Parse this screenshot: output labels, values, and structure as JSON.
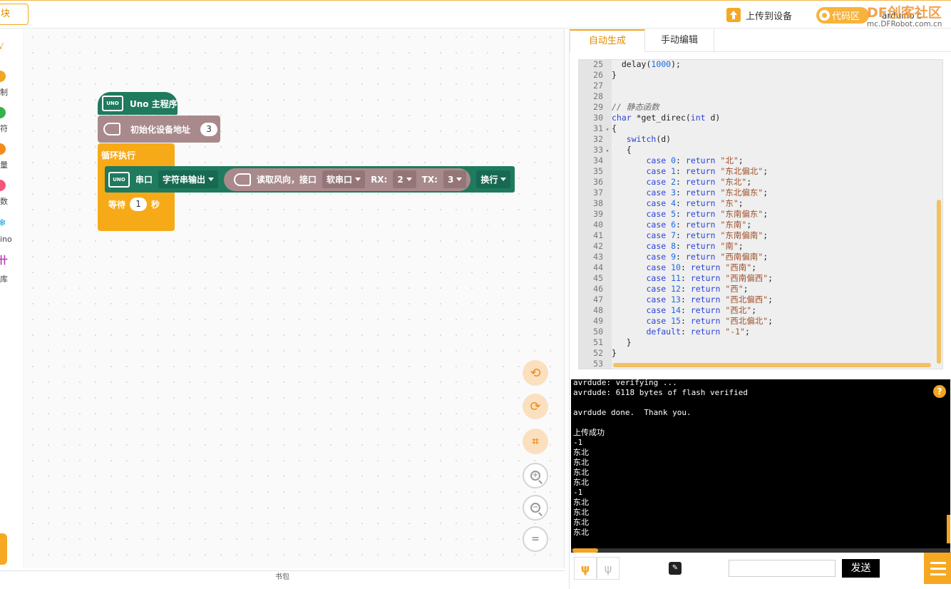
{
  "topbar": {
    "block_tab": "块",
    "upload_label": "上传到设备",
    "code_toggle_label": "代码区",
    "board_select": "arduino c",
    "watermark_top": "DF创客社区",
    "watermark_bottom": "mc.DFRobot.com.cn"
  },
  "toolbox": {
    "head": "√",
    "categories": [
      {
        "label": "制",
        "color": "#f2a522"
      },
      {
        "label": "符",
        "color": "#36b24a"
      },
      {
        "label": "量",
        "color": "#f38b1a"
      },
      {
        "label": "数",
        "color": "#f2577d"
      },
      {
        "label": "ino",
        "color": "#1fa2d8"
      },
      {
        "label": "库",
        "color": "#b53ab3"
      }
    ]
  },
  "blocks": {
    "main_label": "Uno 主程序",
    "uno_text": "UNO",
    "init_label": "初始化设备地址",
    "init_value": "3",
    "loop_label": "循环执行",
    "serial_label": "串口",
    "serial_mode": "字符串输出",
    "read_label": "读取风向，接口",
    "port": "软串口",
    "rx_label": "RX:",
    "rx_value": "2",
    "tx_label": "TX:",
    "tx_value": "3",
    "newline": "换行",
    "wait_label": "等待",
    "wait_value": "1",
    "wait_unit": "秒"
  },
  "workspace_bottom": "书包",
  "tabs": [
    "自动生成",
    "手动编辑"
  ],
  "code_lines": [
    {
      "n": "25",
      "fold": "",
      "text": "  delay(1000);"
    },
    {
      "n": "26",
      "fold": "",
      "text": "}"
    },
    {
      "n": "27",
      "fold": "",
      "text": ""
    },
    {
      "n": "28",
      "fold": "",
      "text": ""
    },
    {
      "n": "29",
      "fold": "",
      "text": "// 静态函数"
    },
    {
      "n": "30",
      "fold": "",
      "text": "char *get_direc(int d)"
    },
    {
      "n": "31",
      "fold": "▾",
      "text": "{"
    },
    {
      "n": "32",
      "fold": "",
      "text": "   switch(d)"
    },
    {
      "n": "33",
      "fold": "▾",
      "text": "   {"
    },
    {
      "n": "34",
      "fold": "",
      "text": "       case 0: return \"北\";"
    },
    {
      "n": "35",
      "fold": "",
      "text": "       case 1: return \"东北偏北\";"
    },
    {
      "n": "36",
      "fold": "",
      "text": "       case 2: return \"东北\";"
    },
    {
      "n": "37",
      "fold": "",
      "text": "       case 3: return \"东北偏东\";"
    },
    {
      "n": "38",
      "fold": "",
      "text": "       case 4: return \"东\";"
    },
    {
      "n": "39",
      "fold": "",
      "text": "       case 5: return \"东南偏东\";"
    },
    {
      "n": "40",
      "fold": "",
      "text": "       case 6: return \"东南\";"
    },
    {
      "n": "41",
      "fold": "",
      "text": "       case 7: return \"东南偏南\";"
    },
    {
      "n": "42",
      "fold": "",
      "text": "       case 8: return \"南\";"
    },
    {
      "n": "43",
      "fold": "",
      "text": "       case 9: return \"西南偏南\";"
    },
    {
      "n": "44",
      "fold": "",
      "text": "       case 10: return \"西南\";"
    },
    {
      "n": "45",
      "fold": "",
      "text": "       case 11: return \"西南偏西\";"
    },
    {
      "n": "46",
      "fold": "",
      "text": "       case 12: return \"西\";"
    },
    {
      "n": "47",
      "fold": "",
      "text": "       case 13: return \"西北偏西\";"
    },
    {
      "n": "48",
      "fold": "",
      "text": "       case 14: return \"西北\";"
    },
    {
      "n": "49",
      "fold": "",
      "text": "       case 15: return \"西北偏北\";"
    },
    {
      "n": "50",
      "fold": "",
      "text": "       default: return \"-1\";"
    },
    {
      "n": "51",
      "fold": "",
      "text": "   }"
    },
    {
      "n": "52",
      "fold": "",
      "text": "}"
    },
    {
      "n": "53",
      "fold": "",
      "text": ""
    }
  ],
  "console_lines": [
    "avrdude: verifying ...",
    "avrdude: 6118 bytes of flash verified",
    "",
    "avrdude done.  Thank you.",
    "",
    "上传成功",
    "-1",
    "东北",
    "东北",
    "东北",
    "东北",
    "-1",
    "东北",
    "东北",
    "东北",
    "东北"
  ],
  "console_help": "?",
  "footer": {
    "input_value": "",
    "send_label": "发送"
  }
}
